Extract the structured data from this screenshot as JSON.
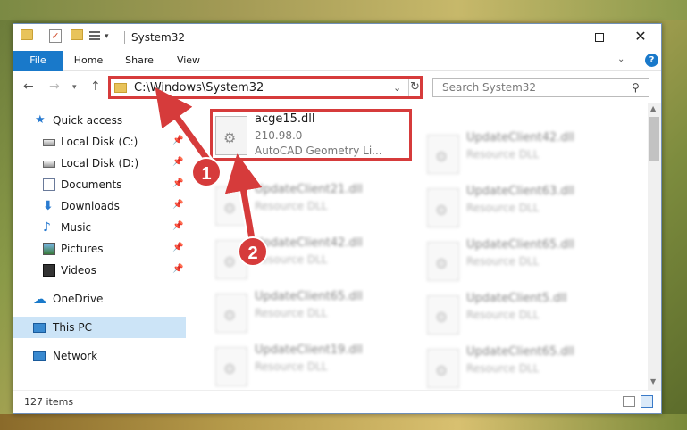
{
  "window": {
    "title": "System32"
  },
  "ribbon": {
    "tabs": [
      "File",
      "Home",
      "Share",
      "View"
    ],
    "help_label": "?"
  },
  "nav": {
    "address": "C:\\Windows\\System32",
    "search_placeholder": "Search System32"
  },
  "sidebar": {
    "items": [
      {
        "label": "Quick access",
        "icon": "star-icon"
      },
      {
        "label": "Local Disk (C:)",
        "icon": "disk-icon",
        "pinned": true
      },
      {
        "label": "Local Disk (D:)",
        "icon": "disk-icon",
        "pinned": true
      },
      {
        "label": "Documents",
        "icon": "documents-icon",
        "pinned": true
      },
      {
        "label": "Downloads",
        "icon": "downloads-icon",
        "pinned": true
      },
      {
        "label": "Music",
        "icon": "music-icon",
        "pinned": true
      },
      {
        "label": "Pictures",
        "icon": "pictures-icon",
        "pinned": true
      },
      {
        "label": "Videos",
        "icon": "videos-icon",
        "pinned": true
      },
      {
        "label": "OneDrive",
        "icon": "onedrive-icon"
      },
      {
        "label": "This PC",
        "icon": "this-pc-icon",
        "selected": true
      },
      {
        "label": "Network",
        "icon": "network-icon"
      }
    ]
  },
  "files": {
    "highlighted": {
      "name": "acge15.dll",
      "version": "210.98.0",
      "description": "AutoCAD Geometry Li..."
    },
    "col1": [
      {
        "name": "UpdateClient21.dll",
        "type": "Resource DLL"
      },
      {
        "name": "UpdateClient42.dll",
        "type": "Resource DLL"
      },
      {
        "name": "UpdateClient65.dll",
        "type": "Resource DLL"
      },
      {
        "name": "UpdateClient19.dll",
        "type": "Resource DLL"
      }
    ],
    "col2": [
      {
        "name": "UpdateClient42.dll",
        "type": "Resource DLL"
      },
      {
        "name": "UpdateClient63.dll",
        "type": "Resource DLL"
      },
      {
        "name": "UpdateClient65.dll",
        "type": "Resource DLL"
      },
      {
        "name": "UpdateClient5.dll",
        "type": "Resource DLL"
      },
      {
        "name": "UpdateClient65.dll",
        "type": "Resource DLL"
      }
    ]
  },
  "status": {
    "item_count": "127 items"
  },
  "annotations": {
    "badge1": "1",
    "badge2": "2"
  },
  "colors": {
    "accent": "#1979ca",
    "highlight": "#d63b3b"
  }
}
